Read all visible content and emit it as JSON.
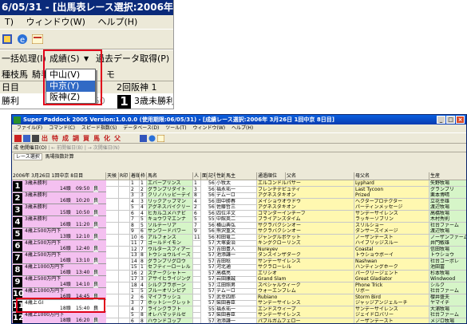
{
  "zoom": {
    "title": "6/05/31 - [出馬表レース選択:2006年",
    "menu": [
      "T)",
      "ウィンドウ(W)",
      "ヘルプ(H)"
    ],
    "toolbar2": [
      "一括処理(I)",
      "成績(S)",
      "▼",
      "過去データ取得(P)"
    ],
    "toolbar3": [
      "種枝馬",
      "騎手",
      "モ"
    ],
    "row1_left": "日目",
    "row1_right": "2回阪神 1",
    "row2_left": "勝利",
    "row2_time": "09:50",
    "row2_num": "1",
    "row2_right": "3歳未勝利",
    "dropdown": [
      {
        "label": "中山(V)",
        "selected": false
      },
      {
        "label": "中京(Y)",
        "selected": true
      },
      {
        "label": "阪神(Z)",
        "selected": false
      }
    ]
  },
  "window": {
    "title": "Super Paddock 2005 Version:1.0.0.0 (使用期限:06/05/31) - [成績レース選択:2006年 3月26日 1回中京 8日目]",
    "menu": [
      "ファイル(F)",
      "コマンド(C)",
      "スピード指数(S)",
      "データベース(D)",
      "ツール(T)",
      "ウィンドウ(W)",
      "ヘルプ(H)"
    ],
    "toolbar_chars": [
      "出",
      "特",
      "成",
      "調",
      "買",
      "馬",
      "化",
      "父"
    ],
    "toolbar2": [
      "成 他開催日(O)",
      "| ← 前開催日(B)",
      "| → 次開催日(N)"
    ],
    "tabs": [
      "レース選択",
      "馬場指数計算"
    ],
    "date_header": "2006年 3月26日 1回中京 8日目"
  },
  "grid": {
    "headers": [
      "天候",
      "R印",
      "着順",
      "枠",
      "馬名",
      "人",
      "面",
      "記号",
      "性齢",
      "馬主",
      "通過順位",
      "父名",
      "母父名",
      "生産"
    ],
    "races": [
      {
        "num": "1",
        "name": "3歳未勝利",
        "heads": "14頭",
        "time": "09:50",
        "track": "良"
      },
      {
        "num": "2",
        "name": "3歳未勝利",
        "heads": "16頭",
        "time": "10:20",
        "track": "良"
      },
      {
        "num": "3",
        "name": "3歳未勝利",
        "heads": "15頭",
        "time": "10:50",
        "track": "良"
      },
      {
        "num": "4",
        "name": "3歳未勝利",
        "heads": "16頭",
        "time": "11:20",
        "track": "良"
      },
      {
        "num": "5",
        "name": "4歳上500万円下",
        "heads": "13頭",
        "time": "12:10",
        "track": "良"
      },
      {
        "num": "6",
        "name": "4歳上500万円下",
        "heads": "16頭",
        "time": "12:40",
        "track": "良"
      },
      {
        "num": "7",
        "name": "4歳上500万円下",
        "heads": "16頭",
        "time": "13:10",
        "track": "良"
      },
      {
        "num": "8",
        "name": "4歳上1000万円下",
        "heads": "16頭",
        "time": "13:40",
        "track": "良"
      },
      {
        "num": "9",
        "name": "4歳上500万円下",
        "heads": "14頭",
        "time": "14:10",
        "track": "良"
      },
      {
        "num": "10",
        "name": "4歳上1000万円下",
        "heads": "16頭",
        "time": "14:45",
        "track": "良"
      },
      {
        "num": "11",
        "name": "4歳上ＧⅠ",
        "heads": "18頭",
        "time": "15:40",
        "track": "良"
      },
      {
        "num": "12",
        "name": "4歳上1000万円下",
        "heads": "18頭",
        "time": "16:20",
        "track": "良"
      }
    ],
    "rows": [
      {
        "r": "1",
        "w": "1",
        "name": "エバープリンス",
        "pop": "1",
        "n": "56",
        "jockey": "小牧太",
        "sire": "エルコンドルパサー",
        "dam": "Lyphard",
        "breeder": "矢野牧場"
      },
      {
        "r": "2",
        "w": "2",
        "name": "グランプリダイト",
        "pop": "3",
        "n": "56",
        "jockey": "福永祐一",
        "sire": "フレンチデピュティ",
        "dam": "Last Tycoon",
        "breeder": "グランプリ"
      },
      {
        "r": "3",
        "w": "3",
        "name": "クリノハッピーデイ",
        "pop": "8",
        "n": "56",
        "jockey": "デムーロ",
        "sire": "アグネスタキオン",
        "dam": "Prized",
        "breeder": "栗本博晴"
      },
      {
        "r": "4",
        "w": "3",
        "name": "リックアップマン",
        "pop": "4",
        "n": "56",
        "jockey": "田中勝春",
        "sire": "メイショウオウドウ",
        "dam": "ヘクタープロテクター",
        "breeder": "立花幸雄"
      },
      {
        "r": "5",
        "w": "4",
        "name": "アグネスパイクリー",
        "pop": "2",
        "n": "56",
        "jockey": "佐藤哲三",
        "sire": "アグネスタキオン",
        "dam": "パーティンメッセージ",
        "breeder": "渡辺牧場"
      },
      {
        "r": "6",
        "w": "4",
        "name": "ヒカルユメハナビ",
        "pop": "6",
        "n": "56",
        "jockey": "四位洋文",
        "sire": "コマンダーインチーフ",
        "dam": "サンデーサイレンス",
        "breeder": "高橋牧場"
      },
      {
        "r": "7",
        "w": "5",
        "name": "キョウワマエンナ",
        "pop": "5",
        "n": "55",
        "jockey": "中館英二",
        "sire": "ブライアンズタイム",
        "dam": "ラッキーソブリン",
        "breeder": "木村秀則"
      },
      {
        "r": "8",
        "w": "5",
        "name": "ソルテーリア",
        "pop": "7",
        "n": "56",
        "jockey": "横山典弘",
        "sire": "サクラバクシンオー",
        "dam": "スリルショー",
        "breeder": "社台ファーム"
      },
      {
        "r": "9",
        "w": "6",
        "name": "サンワードパワー",
        "pop": "9",
        "n": "56",
        "jockey": "熊沢重文",
        "sire": "サクラバクシンオー",
        "dam": "ダンサーズイメージ",
        "breeder": "渡辺牧場"
      },
      {
        "r": "10",
        "w": "6",
        "name": "アルフォンス",
        "pop": "11",
        "n": "56",
        "jockey": "和田竜二",
        "sire": "ジャングルポケット",
        "dam": "ノーザンテースト",
        "breeder": "ノーザンファーム"
      },
      {
        "r": "11",
        "w": "7",
        "name": "ゴールドイモン",
        "pop": "",
        "n": "57",
        "jockey": "大塚要治",
        "sire": "キングクローリンズ",
        "dam": "ハイブリッジスルー",
        "breeder": "井門敏雄"
      },
      {
        "r": "12",
        "w": "7",
        "name": "ウルタースフィアー",
        "pop": "",
        "n": "57",
        "jockey": "吉田豊人",
        "sire": "Nureyev",
        "dam": "Coastal",
        "breeder": "信田牧場"
      },
      {
        "r": "13",
        "w": "8",
        "name": "トウショウルイーズ",
        "pop": "",
        "n": "57",
        "jockey": "池添謙一",
        "sire": "ダンスインザダーク",
        "dam": "トウショウボーイ",
        "breeder": "トウショウ"
      },
      {
        "r": "14",
        "w": "8",
        "name": "グランプリグロウ",
        "pop": "",
        "n": "57",
        "jockey": "吉田稔",
        "sire": "サンデーサイレンス",
        "dam": "Nashwan",
        "breeder": "社台コーポレ"
      },
      {
        "r": "15",
        "w": "1",
        "name": "セフティーローレル",
        "pop": "",
        "n": "57",
        "jockey": "河北通",
        "sire": "サクラローレル",
        "dam": "ハンティングホーク",
        "breeder": "池田富"
      },
      {
        "r": "16",
        "w": "2",
        "name": "スナークシャトー",
        "pop": "",
        "n": "57",
        "jockey": "高橋亮",
        "sire": "エリシオ",
        "dam": "パークリージェント",
        "breeder": "杉本牧場"
      },
      {
        "r": "17",
        "w": "3",
        "name": "アサイヒライジング",
        "pop": "",
        "n": "57",
        "jockey": "岩田康誠",
        "sire": "Grand Slam",
        "dam": "Great Gladiator",
        "breeder": "Windwood"
      },
      {
        "r": "18",
        "w": "4",
        "name": "シルクブラボーン",
        "pop": "",
        "n": "57",
        "jockey": "江田照男",
        "sire": "スペシャルウィーク",
        "dam": "Phone Trick",
        "breeder": "シルク"
      },
      {
        "r": "1",
        "w": "5",
        "name": "ブルーオリンピア",
        "pop": "",
        "n": "57",
        "jockey": "デムーロ",
        "sire": "ウォーエンブレム",
        "dam": "リボー",
        "breeder": "社台ファーム"
      },
      {
        "r": "2",
        "w": "6",
        "name": "マイフラッシュ",
        "pop": "",
        "n": "57",
        "jockey": "武幸四郎",
        "sire": "Rubiano",
        "dam": "Storm Bird",
        "breeder": "櫻井盛夫"
      },
      {
        "r": "3",
        "w": "7",
        "name": "ホットシークレット",
        "pop": "",
        "n": "57",
        "jockey": "柴田善臣",
        "sire": "サンデーサイレンス",
        "dam": "ジャッジアンジェルーチ",
        "breeder": "ヤマイチ"
      },
      {
        "r": "4",
        "w": "7",
        "name": "ラインクラフト",
        "pop": "",
        "n": "55",
        "jockey": "福永祐一",
        "sire": "エンドスウィープ",
        "dam": "サンデーサイレンス",
        "breeder": "大浦牧場"
      },
      {
        "r": "5",
        "w": "8",
        "name": "オレハマッテルゼ",
        "pop": "",
        "n": "57",
        "jockey": "柴田善臣",
        "sire": "サンデーサイレンス",
        "dam": "ジェイドロバリー",
        "breeder": "社台ファーム"
      },
      {
        "r": "6",
        "w": "8",
        "name": "ハウンドコップ",
        "pop": "",
        "n": "57",
        "jockey": "池添謙一",
        "sire": "パブルガムフェロー",
        "dam": "ノーザンテースト",
        "breeder": "メジロ牧場"
      }
    ]
  },
  "colors": {
    "red_highlight": "#e0001a",
    "title_bar": "#0a3bb0",
    "selected_item": "#316ac5",
    "race_pink": "#f4c0f0",
    "cell_green": "#d6f5c8",
    "cell_yellow": "#fff8b0"
  }
}
